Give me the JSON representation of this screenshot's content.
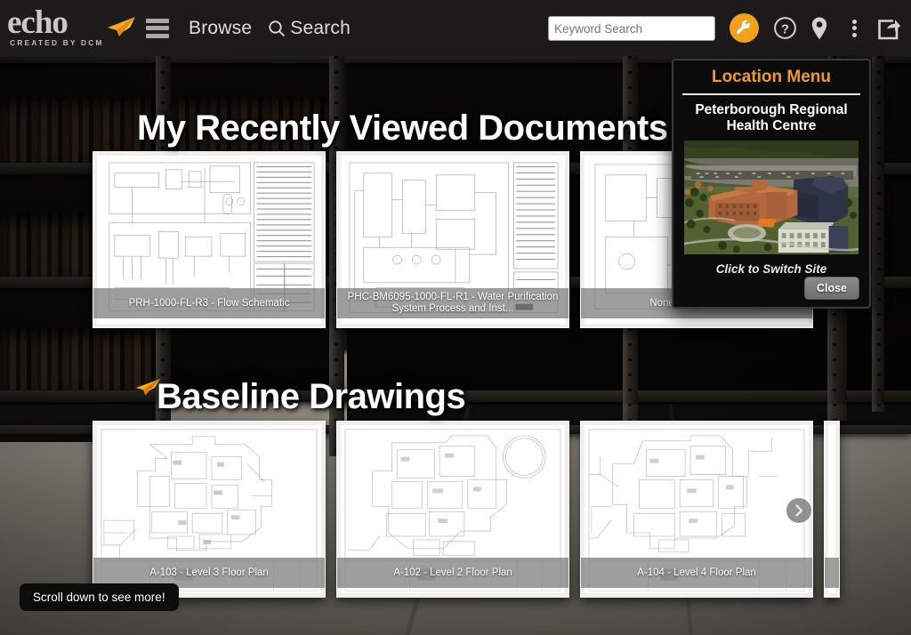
{
  "header": {
    "logo_text": "echo",
    "logo_tagline": "CREATED BY DCM",
    "menu_icon": "hamburger-icon",
    "browse_label": "Browse",
    "search_label": "Search",
    "search_icon": "search-icon",
    "keyword_search_placeholder": "Keyword Search",
    "keyword_search_value": "",
    "keyword_search_icon": "magnifier-icon",
    "tools_icon": "wrench-icon",
    "help_icon": "question-mark-icon",
    "location_icon": "map-pin-icon",
    "more_icon": "kebab-menu-icon",
    "share_icon": "share-icon",
    "accent_color": "#f5a01a",
    "background_color": "#1d1b1a"
  },
  "sections": [
    {
      "id": "recently-viewed",
      "title": "My Recently Viewed Documents",
      "has_plane_icon": false,
      "cards": [
        {
          "caption": "PRH-1000-FL-R3 - Flow Schematic",
          "thumb": "flow-schematic"
        },
        {
          "caption": "PHC-BM6095-1000-FL-R1 - Water Purification System Process and Inst...",
          "thumb": "p-and-id"
        },
        {
          "caption": "None Assigned - C...",
          "thumb": "piping-schematic"
        }
      ]
    },
    {
      "id": "baseline-drawings",
      "title": "Baseline Drawings",
      "has_plane_icon": true,
      "plane_icon": "paper-plane-icon",
      "cards": [
        {
          "caption": "A-103 - Level 3 Floor Plan",
          "thumb": "floor-plan-3"
        },
        {
          "caption": "A-102 - Level 2 Floor Plan",
          "thumb": "floor-plan-2"
        },
        {
          "caption": "A-104 - Level 4 Floor Plan",
          "thumb": "floor-plan-4"
        },
        {
          "caption": "",
          "thumb": "partial"
        }
      ],
      "next_arrow_icon": "chevron-right-icon"
    }
  ],
  "location_menu": {
    "title": "Location Menu",
    "site_name": "Peterborough Regional Health Centre",
    "photo_alt": "aerial-photo-hospital",
    "hint": "Click to Switch Site",
    "close_label": "Close",
    "title_color": "#f0992a"
  },
  "tooltip": {
    "text": "Scroll down to see more!"
  }
}
